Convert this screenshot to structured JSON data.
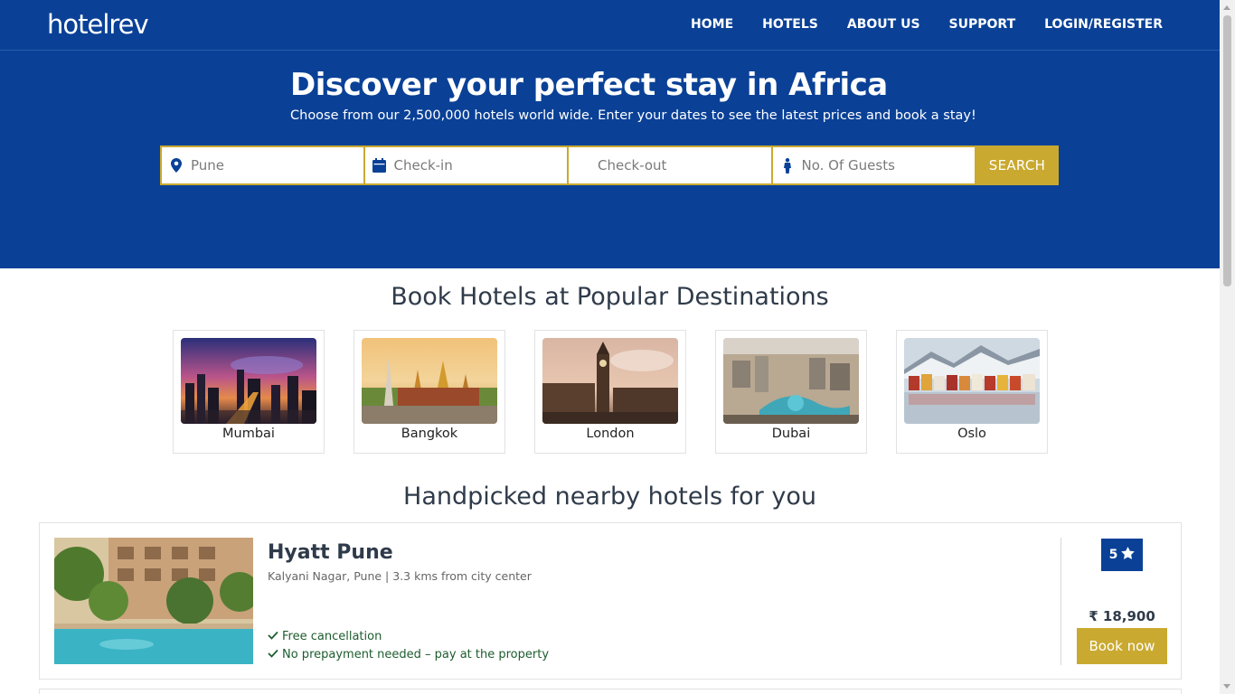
{
  "brand": {
    "logo": "hotelrev"
  },
  "nav": [
    "HOME",
    "HOTELS",
    "ABOUT US",
    "SUPPORT",
    "LOGIN/REGISTER"
  ],
  "hero": {
    "title": "Discover your perfect stay in Africa",
    "subtitle": "Choose from our 2,500,000 hotels world wide. Enter your dates to see the latest prices and book a stay!"
  },
  "search": {
    "location_value": "",
    "location_placeholder": "Pune",
    "checkin_placeholder": "Check-in",
    "checkout_placeholder": "Check-out",
    "guests_placeholder": "No. Of Guests",
    "button_label": "SEARCH"
  },
  "destinations": {
    "title": "Book Hotels at Popular Destinations",
    "items": [
      {
        "label": "Mumbai"
      },
      {
        "label": "Bangkok"
      },
      {
        "label": "London"
      },
      {
        "label": "Dubai"
      },
      {
        "label": "Oslo"
      }
    ]
  },
  "nearby": {
    "title": "Handpicked nearby hotels for you",
    "hotels": [
      {
        "name": "Hyatt Pune",
        "location": "Kalyani Nagar, Pune | 3.3 kms from city center",
        "perks": [
          "Free cancellation",
          "No prepayment needed – pay at the property"
        ],
        "rating": "5",
        "price": "₹ 18,900",
        "book_label": "Book now"
      }
    ]
  },
  "colors": {
    "primary": "#0a4197",
    "accent": "#c9a92f",
    "perk_green": "#1d5c2e"
  }
}
